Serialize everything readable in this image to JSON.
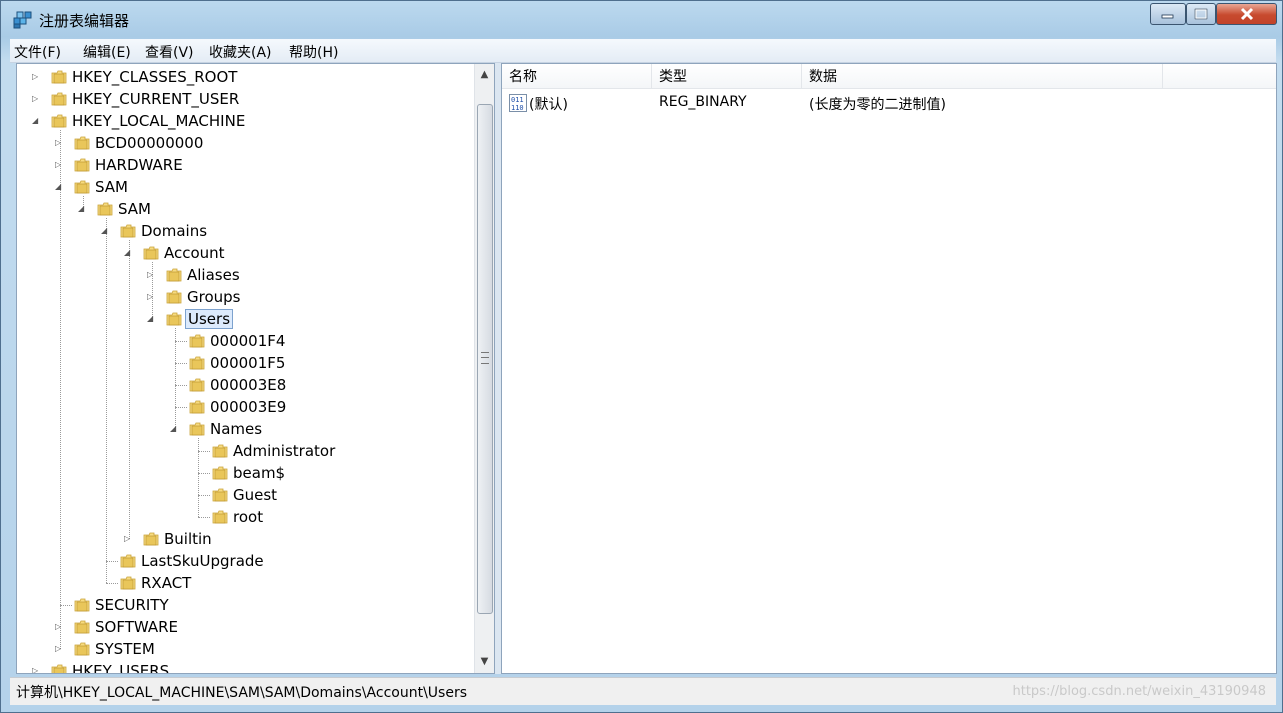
{
  "window": {
    "title": "注册表编辑器",
    "icon": "registry-editor-icon"
  },
  "menubar": {
    "items": [
      "文件(F)",
      "编辑(E)",
      "查看(V)",
      "收藏夹(A)",
      "帮助(H)"
    ]
  },
  "tree": {
    "nodes": [
      {
        "label": "HKEY_CLASSES_ROOT",
        "level": 0,
        "expander": "collapsed"
      },
      {
        "label": "HKEY_CURRENT_USER",
        "level": 0,
        "expander": "collapsed"
      },
      {
        "label": "HKEY_LOCAL_MACHINE",
        "level": 0,
        "expander": "expanded"
      },
      {
        "label": "BCD00000000",
        "level": 1,
        "expander": "collapsed"
      },
      {
        "label": "HARDWARE",
        "level": 1,
        "expander": "collapsed"
      },
      {
        "label": "SAM",
        "level": 1,
        "expander": "expanded"
      },
      {
        "label": "SAM",
        "level": 2,
        "expander": "expanded"
      },
      {
        "label": "Domains",
        "level": 3,
        "expander": "expanded"
      },
      {
        "label": "Account",
        "level": 4,
        "expander": "expanded"
      },
      {
        "label": "Aliases",
        "level": 5,
        "expander": "collapsed"
      },
      {
        "label": "Groups",
        "level": 5,
        "expander": "collapsed"
      },
      {
        "label": "Users",
        "level": 5,
        "expander": "expanded",
        "selected": true
      },
      {
        "label": "000001F4",
        "level": 6,
        "expander": "none"
      },
      {
        "label": "000001F5",
        "level": 6,
        "expander": "none"
      },
      {
        "label": "000003E8",
        "level": 6,
        "expander": "none"
      },
      {
        "label": "000003E9",
        "level": 6,
        "expander": "none"
      },
      {
        "label": "Names",
        "level": 6,
        "expander": "expanded"
      },
      {
        "label": "Administrator",
        "level": 7,
        "expander": "none"
      },
      {
        "label": "beam$",
        "level": 7,
        "expander": "none"
      },
      {
        "label": "Guest",
        "level": 7,
        "expander": "none"
      },
      {
        "label": "root",
        "level": 7,
        "expander": "none"
      },
      {
        "label": "Builtin",
        "level": 4,
        "expander": "collapsed"
      },
      {
        "label": "LastSkuUpgrade",
        "level": 3,
        "expander": "none"
      },
      {
        "label": "RXACT",
        "level": 3,
        "expander": "none"
      },
      {
        "label": "SECURITY",
        "level": 1,
        "expander": "none"
      },
      {
        "label": "SOFTWARE",
        "level": 1,
        "expander": "collapsed"
      },
      {
        "label": "SYSTEM",
        "level": 1,
        "expander": "collapsed"
      },
      {
        "label": "HKEY_USERS",
        "level": 0,
        "expander": "collapsed"
      }
    ]
  },
  "list": {
    "columns": [
      "名称",
      "类型",
      "数据"
    ],
    "rows": [
      {
        "name": "(默认)",
        "type": "REG_BINARY",
        "data": "(长度为零的二进制值)",
        "icon": "binary-value-icon"
      }
    ]
  },
  "statusbar": {
    "path": "计算机\\HKEY_LOCAL_MACHINE\\SAM\\SAM\\Domains\\Account\\Users",
    "watermark": "https://blog.csdn.net/weixin_43190948"
  },
  "colors": {
    "folder": "#e9c65a",
    "selection_bg": "#dceafc",
    "selection_border": "#7da2ce",
    "close_button": "#c7482d"
  }
}
